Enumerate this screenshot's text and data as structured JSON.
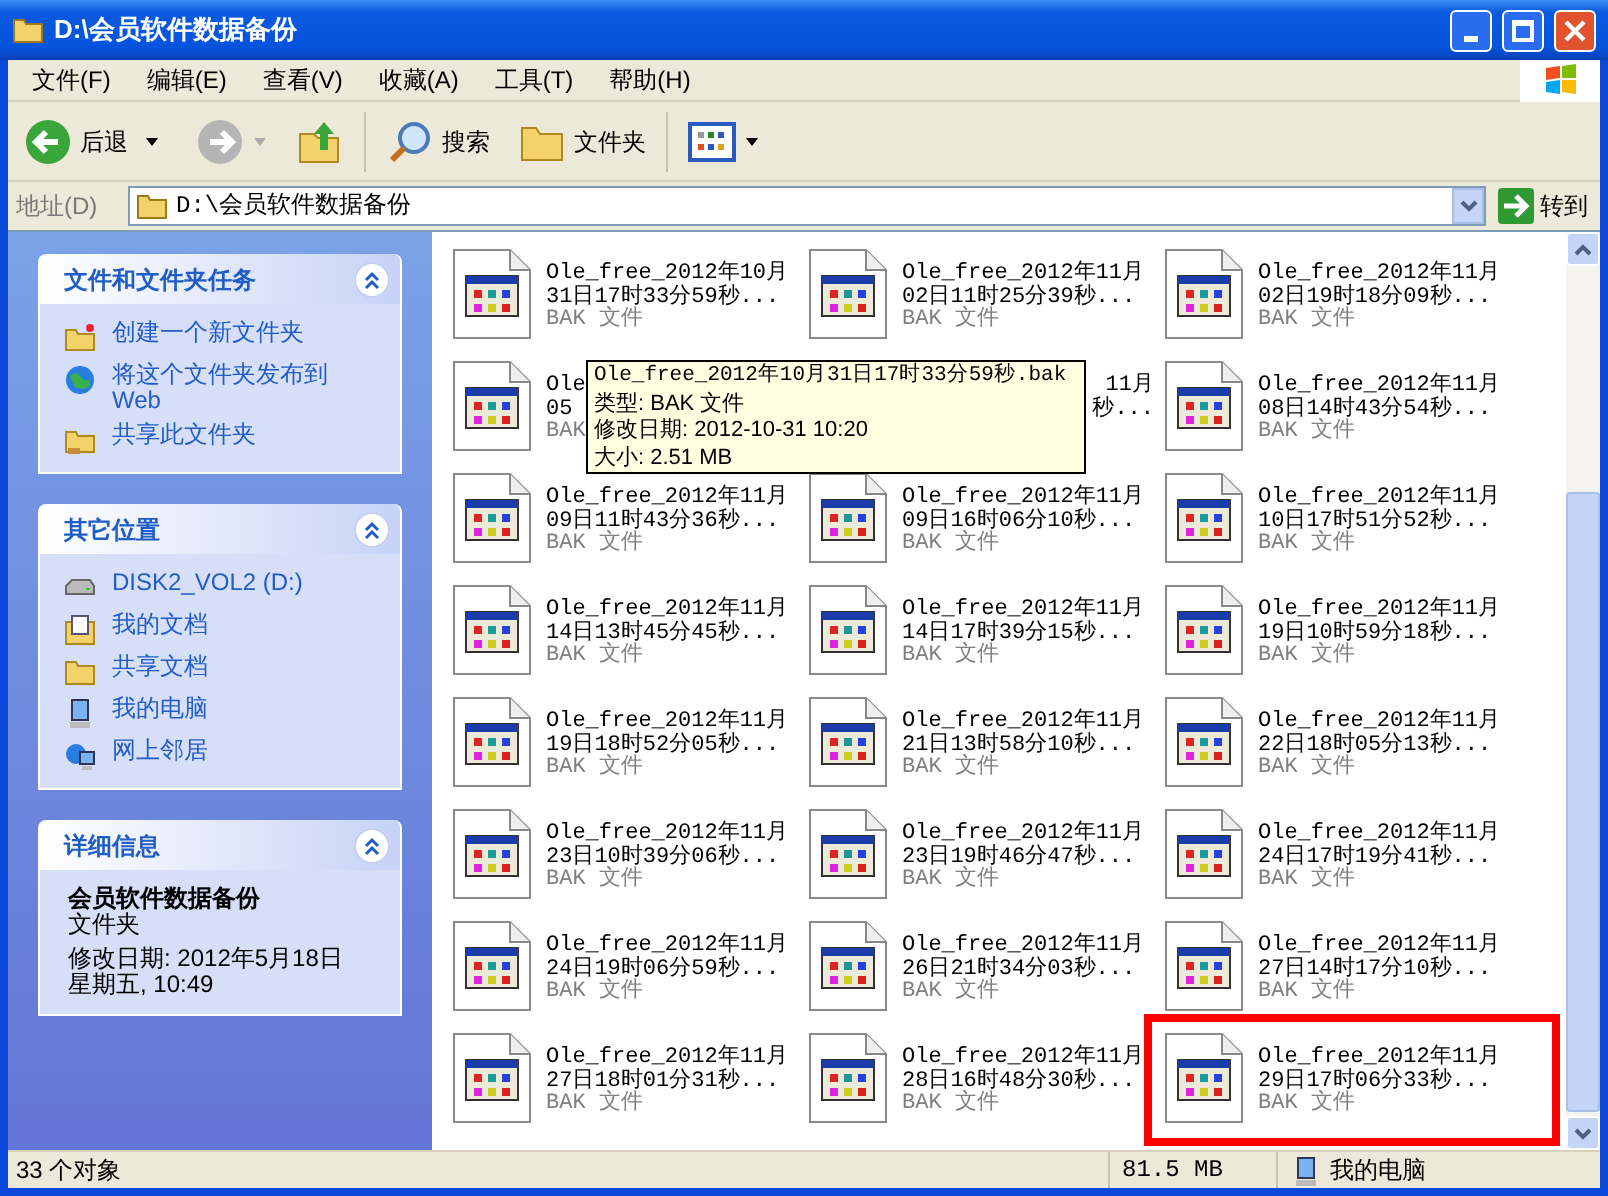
{
  "window": {
    "title": "D:\\会员软件数据备份"
  },
  "menu": [
    "文件(F)",
    "编辑(E)",
    "查看(V)",
    "收藏(A)",
    "工具(T)",
    "帮助(H)"
  ],
  "toolbar": {
    "back": "后退",
    "search": "搜索",
    "folders": "文件夹"
  },
  "address": {
    "label": "地址(D)",
    "value": "D:\\会员软件数据备份",
    "go": "转到"
  },
  "panels": [
    {
      "title": "文件和文件夹任务",
      "kind": "links",
      "items": [
        {
          "label": "创建一个新文件夹"
        },
        {
          "label": "将这个文件夹发布到\nWeb"
        },
        {
          "label": "共享此文件夹"
        }
      ]
    },
    {
      "title": "其它位置",
      "kind": "links",
      "items": [
        {
          "label": "DISK2_VOL2 (D:)"
        },
        {
          "label": "我的文档"
        },
        {
          "label": "共享文档"
        },
        {
          "label": "我的电脑"
        },
        {
          "label": "网上邻居"
        }
      ]
    },
    {
      "title": "详细信息",
      "kind": "details",
      "name": "会员软件数据备份",
      "type": "文件夹",
      "modified": "修改日期: 2012年5月18日",
      "weekday_time": "星期五, 10:49"
    }
  ],
  "files": [
    {
      "kind": "full",
      "line1": "Ole_free_2012年10月",
      "line2": "31日17时33分59秒...",
      "type": "BAK 文件",
      "highlighted": false
    },
    {
      "kind": "full",
      "line1": "Ole_free_2012年11月",
      "line2": "02日11时25分39秒...",
      "type": "BAK 文件",
      "highlighted": false
    },
    {
      "kind": "full",
      "line1": "Ole_free_2012年11月",
      "line2": "02日19时18分09秒...",
      "type": "BAK 文件",
      "highlighted": false
    },
    {
      "kind": "covered-left",
      "line1": "Ole",
      "line2": "05",
      "type": "BAK",
      "highlighted": false
    },
    {
      "kind": "covered-right",
      "line1": "11月",
      "line2": "秒...",
      "highlighted": false
    },
    {
      "kind": "full",
      "line1": "Ole_free_2012年11月",
      "line2": "08日14时43分54秒...",
      "type": "BAK 文件",
      "highlighted": false
    },
    {
      "kind": "full",
      "line1": "Ole_free_2012年11月",
      "line2": "09日11时43分36秒...",
      "type": "BAK 文件",
      "highlighted": false
    },
    {
      "kind": "full",
      "line1": "Ole_free_2012年11月",
      "line2": "09日16时06分10秒...",
      "type": "BAK 文件",
      "highlighted": false
    },
    {
      "kind": "full",
      "line1": "Ole_free_2012年11月",
      "line2": "10日17时51分52秒...",
      "type": "BAK 文件",
      "highlighted": false
    },
    {
      "kind": "full",
      "line1": "Ole_free_2012年11月",
      "line2": "14日13时45分45秒...",
      "type": "BAK 文件",
      "highlighted": false
    },
    {
      "kind": "full",
      "line1": "Ole_free_2012年11月",
      "line2": "14日17时39分15秒...",
      "type": "BAK 文件",
      "highlighted": false
    },
    {
      "kind": "full",
      "line1": "Ole_free_2012年11月",
      "line2": "19日10时59分18秒...",
      "type": "BAK 文件",
      "highlighted": false
    },
    {
      "kind": "full",
      "line1": "Ole_free_2012年11月",
      "line2": "19日18时52分05秒...",
      "type": "BAK 文件",
      "highlighted": false
    },
    {
      "kind": "full",
      "line1": "Ole_free_2012年11月",
      "line2": "21日13时58分10秒...",
      "type": "BAK 文件",
      "highlighted": false
    },
    {
      "kind": "full",
      "line1": "Ole_free_2012年11月",
      "line2": "22日18时05分13秒...",
      "type": "BAK 文件",
      "highlighted": false
    },
    {
      "kind": "full",
      "line1": "Ole_free_2012年11月",
      "line2": "23日10时39分06秒...",
      "type": "BAK 文件",
      "highlighted": false
    },
    {
      "kind": "full",
      "line1": "Ole_free_2012年11月",
      "line2": "23日19时46分47秒...",
      "type": "BAK 文件",
      "highlighted": false
    },
    {
      "kind": "full",
      "line1": "Ole_free_2012年11月",
      "line2": "24日17时19分41秒...",
      "type": "BAK 文件",
      "highlighted": false
    },
    {
      "kind": "full",
      "line1": "Ole_free_2012年11月",
      "line2": "24日19时06分59秒...",
      "type": "BAK 文件",
      "highlighted": false
    },
    {
      "kind": "full",
      "line1": "Ole_free_2012年11月",
      "line2": "26日21时34分03秒...",
      "type": "BAK 文件",
      "highlighted": false
    },
    {
      "kind": "full",
      "line1": "Ole_free_2012年11月",
      "line2": "27日14时17分10秒...",
      "type": "BAK 文件",
      "highlighted": false
    },
    {
      "kind": "full",
      "line1": "Ole_free_2012年11月",
      "line2": "27日18时01分31秒...",
      "type": "BAK 文件",
      "highlighted": false
    },
    {
      "kind": "full",
      "line1": "Ole_free_2012年11月",
      "line2": "28日16时48分30秒...",
      "type": "BAK 文件",
      "highlighted": false
    },
    {
      "kind": "full",
      "line1": "Ole_free_2012年11月",
      "line2": "29日17时06分33秒...",
      "type": "BAK 文件",
      "highlighted": true
    }
  ],
  "tooltip": {
    "title": "Ole_free_2012年10月31日17时33分59秒.bak",
    "type": "类型: BAK 文件",
    "modified": "修改日期: 2012-10-31 10:20",
    "size": "大小: 2.51 MB"
  },
  "status_bar": {
    "count": "33 个对象",
    "size": "81.5 MB",
    "location": "我的电脑"
  }
}
